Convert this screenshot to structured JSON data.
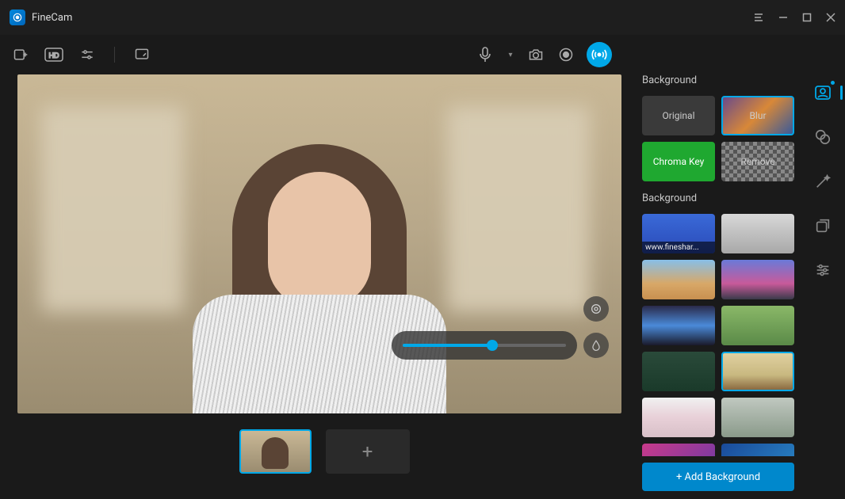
{
  "app": {
    "title": "FineCam"
  },
  "toolbar": {
    "mic_dropdown": "▾"
  },
  "panel": {
    "heading1": "Background",
    "heading2": "Background",
    "modes": {
      "original": "Original",
      "blur": "Blur",
      "chroma": "Chroma Key",
      "remove": "Remove"
    },
    "bg_caption1": "www.fineshar...",
    "add_label": "+ Add Background"
  },
  "thumbs": {
    "add_symbol": "+"
  },
  "slider": {
    "value_percent": 55
  }
}
